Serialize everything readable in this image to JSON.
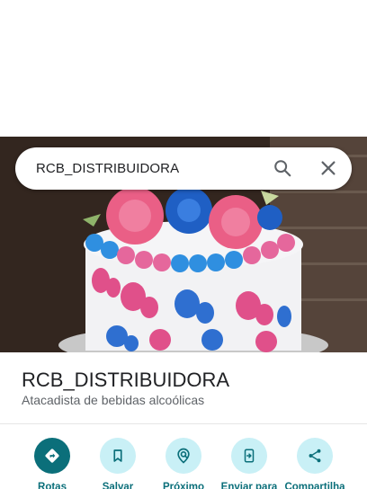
{
  "search": {
    "query": "RCB_DISTRIBUIDORA"
  },
  "place": {
    "name": "RCB_DISTRIBUIDORA",
    "category": "Atacadista de bebidas alcoólicas"
  },
  "actions": [
    {
      "label": "Rotas",
      "icon": "directions-icon"
    },
    {
      "label": "Salvar",
      "icon": "bookmark-icon"
    },
    {
      "label": "Próximo",
      "icon": "nearby-icon"
    },
    {
      "label": "Enviar para",
      "icon": "send-to-phone-icon"
    },
    {
      "label": "Compartilha",
      "icon": "share-icon"
    }
  ],
  "colors": {
    "accent": "#0b6f7a",
    "action_bg": "#c9f0f6",
    "title": "#202124",
    "subtitle": "#5f6368"
  }
}
